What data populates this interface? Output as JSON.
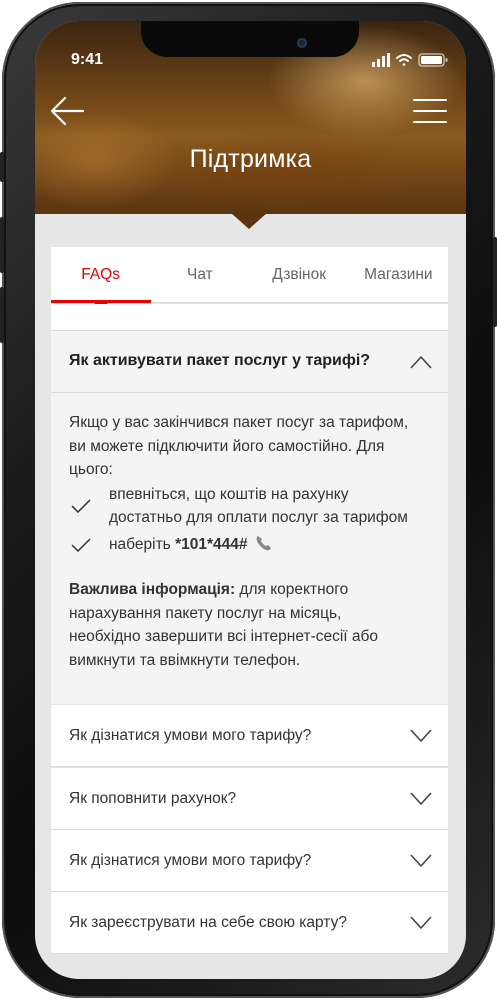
{
  "status_bar": {
    "time": "9:41"
  },
  "header": {
    "title": "Підтримка"
  },
  "tabs": [
    {
      "label": "FAQs",
      "active": true
    },
    {
      "label": "Чат",
      "active": false
    },
    {
      "label": "Дзвінок",
      "active": false
    },
    {
      "label": "Магазини",
      "active": false
    }
  ],
  "faq_open": {
    "question": "Як активувати пакет послуг у тарифі?",
    "intro": "Якщо у вас закінчився пакет посуг за тарифом, ви можете підключити його самостійно. Для цього:",
    "steps": [
      {
        "text": "впевніться, що коштів на рахунку достатньо для оплати послуг за тарифом"
      },
      {
        "text": "наберіть ",
        "code": "*101*444#"
      }
    ],
    "note_label": "Важлива інформація:",
    "note_text": " для коректного нарахування пакету послуг на місяць, необхідно завершити всі інтернет-сесії або вимкнути та ввімкнути телефон."
  },
  "faq_items": [
    {
      "question": "Як дізнатися умови мого тарифу?"
    },
    {
      "question": "Як поповнити рахунок?"
    },
    {
      "question": "Як дізнатися умови мого тарифу?"
    },
    {
      "question": "Як зареєструвати на себе свою карту?"
    }
  ],
  "colors": {
    "accent": "#e60000"
  }
}
